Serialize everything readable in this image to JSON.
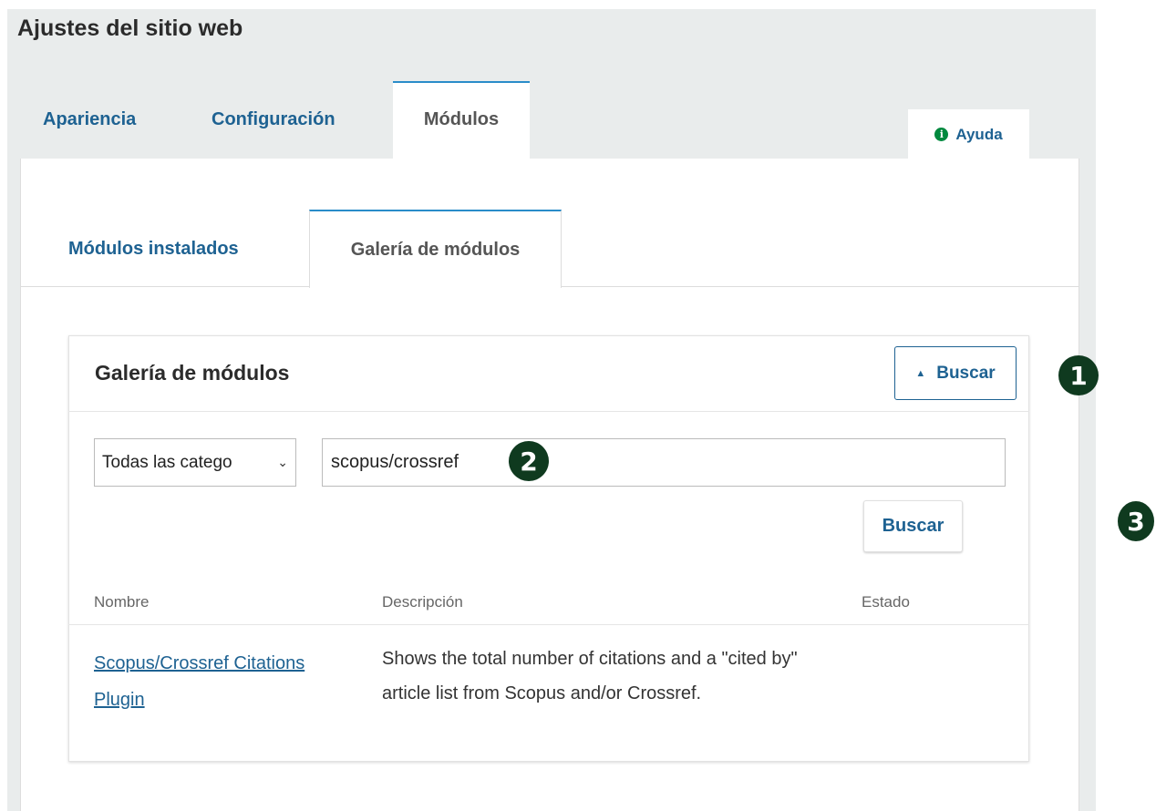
{
  "page": {
    "title": "Ajustes del sitio web"
  },
  "tabs": [
    {
      "label": "Apariencia"
    },
    {
      "label": "Configuración"
    },
    {
      "label": "Módulos"
    }
  ],
  "help": {
    "icon": "info-icon",
    "label": "Ayuda"
  },
  "subtabs": [
    {
      "label": "Módulos instalados"
    },
    {
      "label": "Galería de módulos"
    }
  ],
  "gallery": {
    "title": "Galería de módulos",
    "toggle_label": "Buscar",
    "category_select": {
      "value": "Todas las catego",
      "icon": "chevron-down-icon"
    },
    "search_value": "scopus/crossref",
    "search_button": "Buscar",
    "columns": [
      "Nombre",
      "Descripción",
      "Estado"
    ],
    "rows": [
      {
        "name": "Scopus/Crossref Citations Plugin",
        "description": "Shows the total number of citations and a \"cited by\" article list from Scopus and/or Crossref.",
        "status": ""
      }
    ]
  },
  "annotations": [
    "1",
    "2",
    "3"
  ],
  "colors": {
    "link": "#1e6292",
    "accent": "#2a8cc9",
    "badge": "#0f3a1f",
    "help_icon": "#00893e"
  }
}
